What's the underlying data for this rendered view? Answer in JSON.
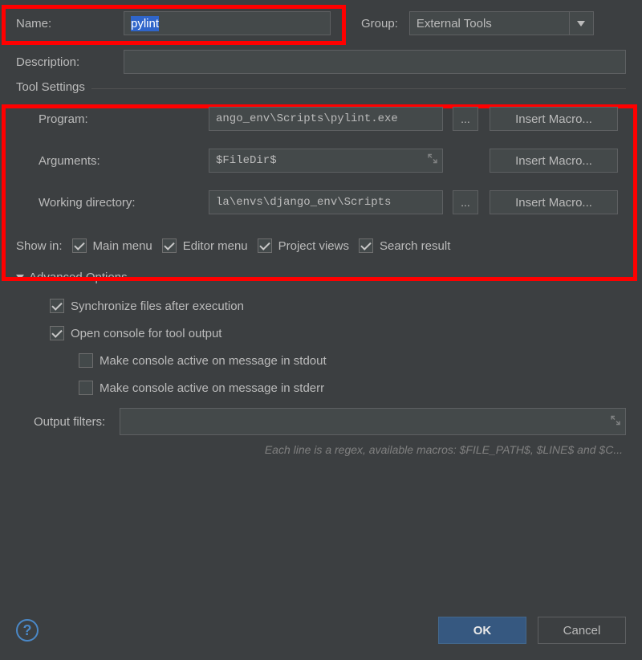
{
  "header": {
    "name_label": "Name:",
    "name_value": "pylint",
    "group_label": "Group:",
    "group_value": "External Tools",
    "description_label": "Description:",
    "description_value": ""
  },
  "tool_settings": {
    "legend": "Tool Settings",
    "program_label": "Program:",
    "program_value": "ango_env\\Scripts\\pylint.exe",
    "arguments_label": "Arguments:",
    "arguments_value": "$FileDir$",
    "workdir_label": "Working directory:",
    "workdir_value": "la\\envs\\django_env\\Scripts",
    "browse_label": "...",
    "insert_macro_label": "Insert Macro..."
  },
  "show_in": {
    "label": "Show in:",
    "main_menu": "Main menu",
    "editor_menu": "Editor menu",
    "project_views": "Project views",
    "search_results": "Search result"
  },
  "advanced": {
    "header": "Advanced Options",
    "sync_files": "Synchronize files after execution",
    "open_console": "Open console for tool output",
    "active_stdout": "Make console active on message in stdout",
    "active_stderr": "Make console active on message in stderr",
    "output_filters_label": "Output filters:",
    "output_filters_value": "",
    "hint": "Each line is a regex, available macros: $FILE_PATH$, $LINE$ and $C..."
  },
  "footer": {
    "ok": "OK",
    "cancel": "Cancel"
  }
}
